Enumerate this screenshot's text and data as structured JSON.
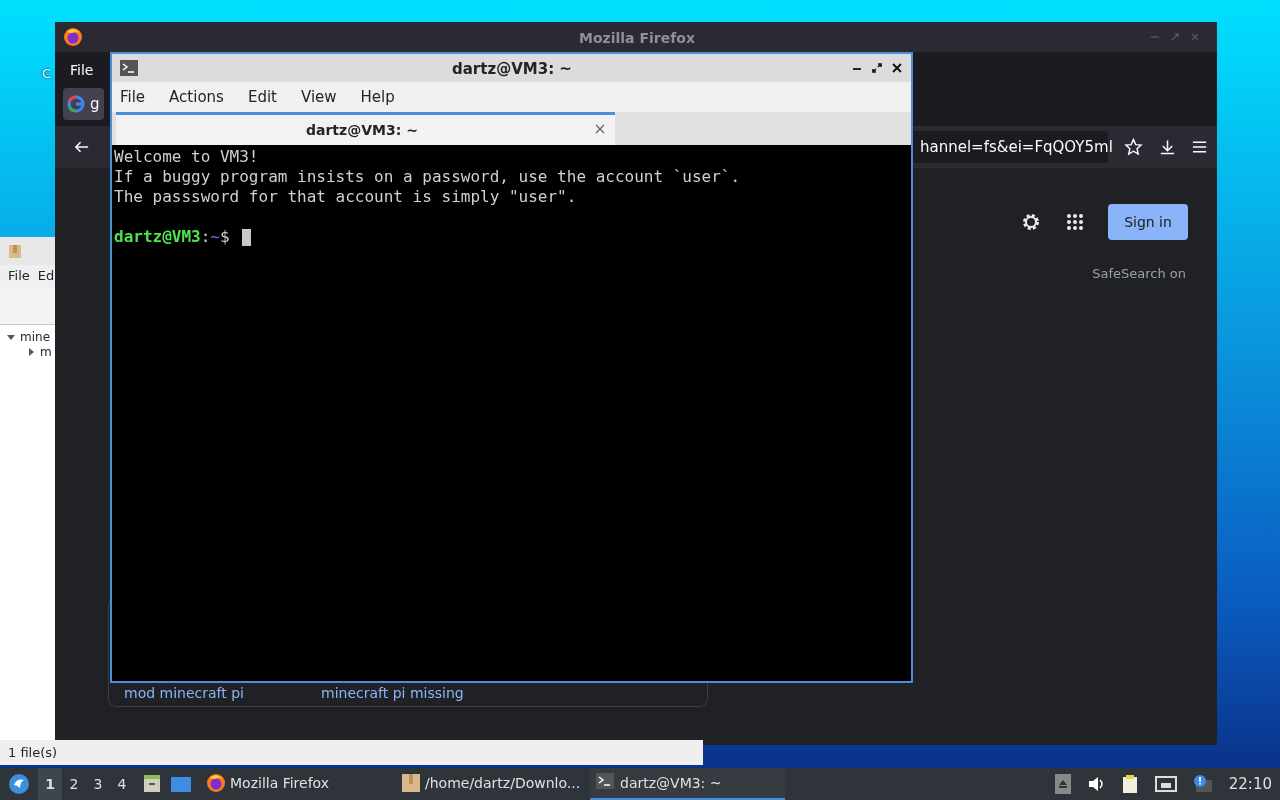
{
  "desktop": {
    "icon_label": "C"
  },
  "firefox": {
    "title": "Mozilla Firefox",
    "menu": [
      "File"
    ],
    "tab": {
      "label": "g"
    },
    "url": "hannel=fs&ei=FqQOY5ml",
    "page": {
      "sign_in": "Sign in",
      "safesearch": "SafeSearch on",
      "related": [
        "mod minecraft pi",
        "minecraft pi missing"
      ]
    }
  },
  "file_manager": {
    "menu": [
      "File",
      "Ed"
    ],
    "tree": [
      {
        "label": "mine",
        "expanded": true,
        "children": [
          {
            "label": "m",
            "expanded": false
          }
        ]
      }
    ],
    "status": "1 file(s)"
  },
  "terminal": {
    "title": "dartz@VM3: ~",
    "menu": [
      "File",
      "Actions",
      "Edit",
      "View",
      "Help"
    ],
    "tabs": [
      {
        "label": "dartz@VM3: ~",
        "selected": true
      }
    ],
    "lines": [
      "Welcome to VM3!",
      "If a buggy program insists on a password, use the account `user`.",
      "The passsword for that account is simply \"user\"."
    ],
    "prompt": {
      "user_host": "dartz@VM3",
      "separator": ":",
      "path": "~",
      "symbol": "$"
    }
  },
  "taskbar": {
    "desktops": [
      {
        "label": "1",
        "selected": true
      },
      {
        "label": "2",
        "selected": false
      },
      {
        "label": "3",
        "selected": false
      },
      {
        "label": "4",
        "selected": false
      }
    ],
    "tasks": [
      {
        "kind": "firefox",
        "label": "Mozilla Firefox",
        "selected": false
      },
      {
        "kind": "folder",
        "label": "/home/dartz/Downlo...",
        "selected": false
      },
      {
        "kind": "terminal",
        "label": "dartz@VM3: ~",
        "selected": true
      }
    ],
    "clock": "22:10"
  }
}
